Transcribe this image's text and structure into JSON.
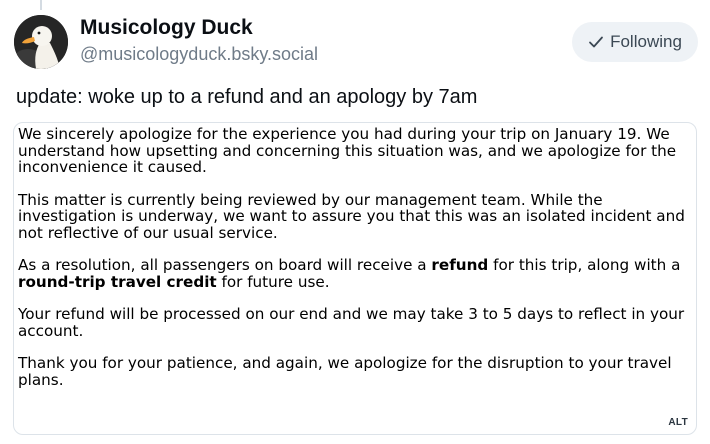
{
  "post": {
    "author_name": "Musicology Duck",
    "author_handle": "@musicologyduck.bsky.social",
    "follow_label": "Following",
    "text": "update: woke up to a refund and an apology by 7am"
  },
  "image": {
    "alt_badge": "ALT",
    "paragraphs": [
      {
        "text": "We sincerely apologize for the experience you had during your trip on January 19. We understand how upsetting and concerning this situation was, and we apologize for the inconvenience it caused."
      },
      {
        "text": "This matter is currently being reviewed by our management team. While the investigation is underway, we want to assure you that this was an isolated incident and not reflective of our usual service."
      },
      {
        "p1": "As a resolution, all passengers on board will receive a ",
        "b1": "refund",
        "p2": " for this trip, along with a ",
        "b2": "round-trip travel credit",
        "p3": " for future use."
      },
      {
        "text": "Your refund will be processed on our end and we may take 3 to 5 days to reflect in your account."
      },
      {
        "text": "Thank you for your patience, and again, we apologize for the disruption to your travel plans."
      }
    ]
  },
  "icons": {
    "follow": "check-icon",
    "avatar": "duck-avatar"
  }
}
